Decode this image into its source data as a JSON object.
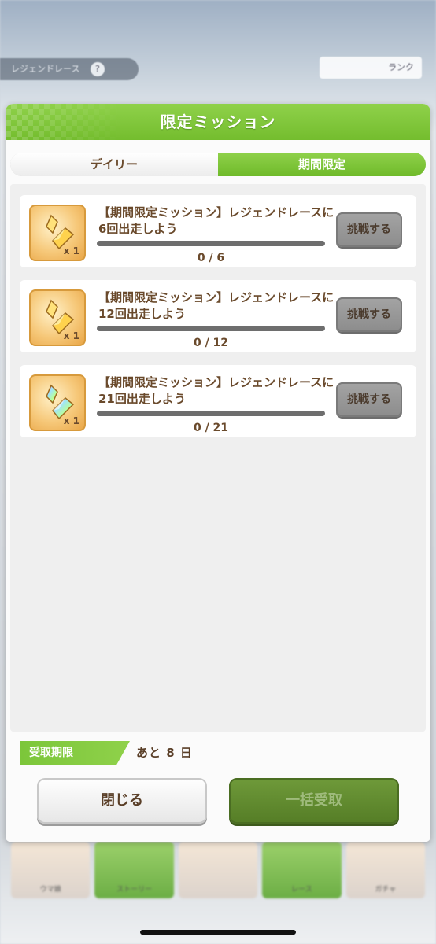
{
  "background": {
    "top_left_label": "レジェンドレース",
    "top_left_help": "?",
    "top_right_label": "ランク",
    "bottom_items": [
      "ウマ娘",
      "ストーリー",
      "",
      "レース",
      "ガチャ"
    ]
  },
  "dialog": {
    "title": "限定ミッション",
    "tabs": [
      {
        "label": "デイリー",
        "active": false
      },
      {
        "label": "期間限定",
        "active": true
      }
    ],
    "missions": [
      {
        "title": "【期間限定ミッション】レジェンドレースに6回出走しよう",
        "progress_text": "0 / 6",
        "progress": 0,
        "reward_qty": "x 1",
        "reward_icon": "gold-crystal-icon",
        "button": "挑戦する"
      },
      {
        "title": "【期間限定ミッション】レジェンドレースに12回出走しよう",
        "progress_text": "0 / 12",
        "progress": 0,
        "reward_qty": "x 1",
        "reward_icon": "gold-crystal-icon",
        "button": "挑戦する"
      },
      {
        "title": "【期間限定ミッション】レジェンドレースに21回出走しよう",
        "progress_text": "0 / 21",
        "progress": 0,
        "reward_qty": "x 1",
        "reward_icon": "rainbow-crystal-icon",
        "button": "挑戦する"
      }
    ],
    "deadline_label": "受取期限",
    "deadline_value": "あと 8 日",
    "close_button": "閉じる",
    "receive_all_button": "一括受取"
  },
  "colors": {
    "accent_green": "#7cc63a",
    "text_brown": "#6a4a2c",
    "disabled_green": "#557d26"
  }
}
